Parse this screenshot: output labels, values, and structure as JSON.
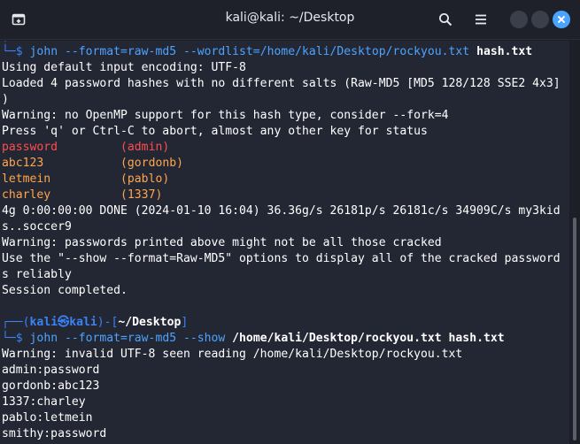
{
  "window": {
    "title": "kali@kali: ~/Desktop"
  },
  "colors": {
    "prompt_blue": "#3b82f6",
    "command": "#4ea3ff",
    "cracked_password": "#ff4d4d",
    "cracked_user": "#ffa64d",
    "close_button": "#4aa3ff"
  },
  "terminal": {
    "cmd1": {
      "prefix": "└─$ ",
      "command": "john --format=raw-md5 --wordlist=/home/kali/Desktop/rockyou.txt",
      "arg": " hash.txt"
    },
    "output1": [
      "Using default input encoding: UTF-8",
      "Loaded 4 password hashes with no different salts (Raw-MD5 [MD5 128/128 SSE2 4x3]",
      ")",
      "Warning: no OpenMP support for this hash type, consider --fork=4",
      "Press 'q' or Ctrl-C to abort, almost any other key for status"
    ],
    "cracked": [
      {
        "password": "password",
        "pad": "         ",
        "user": "(admin)",
        "pw_color": "red"
      },
      {
        "password": "abc123",
        "pad": "           ",
        "user": "(gordonb)",
        "pw_color": "orange"
      },
      {
        "password": "letmein",
        "pad": "          ",
        "user": "(pablo)",
        "pw_color": "orange"
      },
      {
        "password": "charley",
        "pad": "          ",
        "user": "(1337)",
        "pw_color": "orange"
      }
    ],
    "output2": [
      "4g 0:00:00:00 DONE (2024-01-10 16:04) 36.36g/s 26181p/s 26181c/s 34909C/s my3kid",
      "s..soccer9",
      "Warning: passwords printed above might not be all those cracked",
      "Use the \"--show --format=Raw-MD5\" options to display all of the cracked password",
      "s reliably",
      "Session completed."
    ],
    "prompt2": {
      "open": "┌──(",
      "user": "kali",
      "at": "㉿",
      "host": "kali",
      "mid": ")-[",
      "path": "~/Desktop",
      "close": "]"
    },
    "cmd2": {
      "prefix": "└─$ ",
      "command": "john --format=raw-md5 --show",
      "arg": " /home/kali/Desktop/rockyou.txt hash.txt"
    },
    "output3": [
      "Warning: invalid UTF-8 seen reading /home/kali/Desktop/rockyou.txt",
      "admin:password",
      "gordonb:abc123",
      "1337:charley",
      "pablo:letmein",
      "smithy:password"
    ]
  }
}
